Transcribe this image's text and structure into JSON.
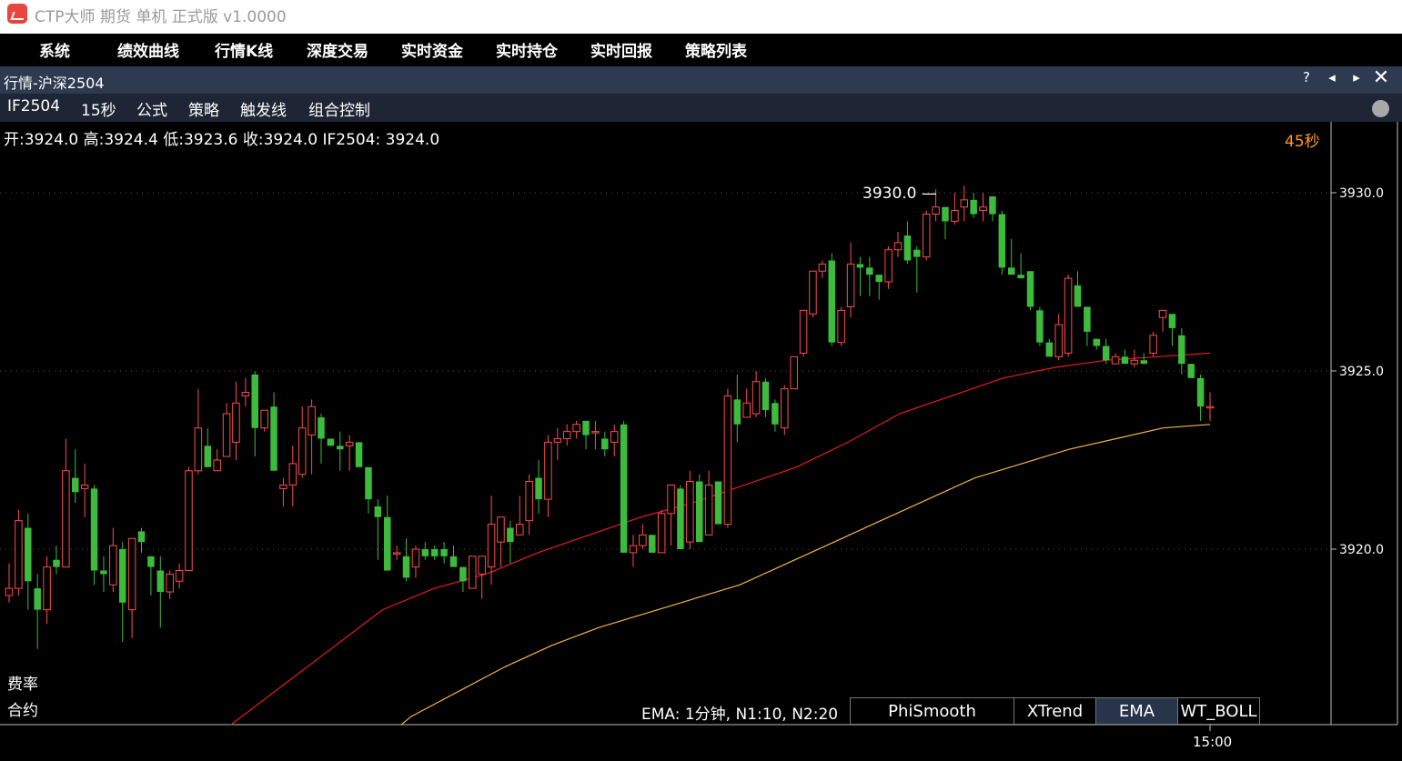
{
  "window": {
    "title": "CTP大师 期货 单机 正式版 v1.0000"
  },
  "menu": [
    "系统",
    "绩效曲线",
    "行情K线",
    "深度交易",
    "实时资金",
    "实时持仓",
    "实时回报",
    "策略列表"
  ],
  "panel": {
    "title": "行情-沪深2504",
    "help": "?",
    "prev": "◂",
    "next": "▸",
    "close": "✕"
  },
  "toolbar": [
    "IF2504",
    "15秒",
    "公式",
    "策略",
    "触发线",
    "组合控制"
  ],
  "quote_line": "开:3924.0 高:3924.4 低:3923.6 收:3924.0 IF2504: 3924.0",
  "period_label": "45秒",
  "high_marker": "3930.0 —",
  "side_labels": {
    "rate": "费率",
    "contract": "合约"
  },
  "indicator": {
    "info": "EMA: 1分钟, N1:10, N2:20",
    "tabs": [
      "PhiSmooth",
      "XTrend",
      "EMA",
      "WT_BOLL"
    ],
    "active": "EMA"
  },
  "colors": {
    "up": "#ff4b4b",
    "down": "#3dbb3d",
    "ema_fast": "#e81c1c",
    "ema_slow": "#f2b24a",
    "accent": "#ff9a1e"
  },
  "chart_data": {
    "type": "candlestick",
    "symbol": "IF2504",
    "period": "15秒",
    "y_ticks": [
      3930.0,
      3925.0,
      3920.0
    ],
    "x_ticks": [
      "15:00"
    ],
    "ohlc": [
      [
        3918.7,
        3919.6,
        3918.5,
        3918.9
      ],
      [
        3918.9,
        3921.1,
        3918.7,
        3920.8
      ],
      [
        3920.6,
        3921.0,
        3918.3,
        3919.1
      ],
      [
        3918.9,
        3919.3,
        3917.2,
        3918.3
      ],
      [
        3918.3,
        3919.8,
        3917.9,
        3919.5
      ],
      [
        3919.7,
        3920.1,
        3919.3,
        3919.5
      ],
      [
        3919.5,
        3923.1,
        3919.5,
        3922.2
      ],
      [
        3922.0,
        3922.8,
        3921.3,
        3921.6
      ],
      [
        3921.7,
        3922.4,
        3920.9,
        3921.8
      ],
      [
        3921.7,
        3921.8,
        3919.0,
        3919.4
      ],
      [
        3919.4,
        3919.8,
        3918.8,
        3919.3
      ],
      [
        3919.0,
        3920.6,
        3918.8,
        3920.1
      ],
      [
        3920.0,
        3920.2,
        3917.4,
        3918.5
      ],
      [
        3918.3,
        3920.2,
        3917.5,
        3920.3
      ],
      [
        3920.5,
        3920.6,
        3919.9,
        3920.2
      ],
      [
        3919.8,
        3919.8,
        3918.7,
        3919.5
      ],
      [
        3919.4,
        3919.8,
        3917.8,
        3918.8
      ],
      [
        3918.8,
        3919.4,
        3918.6,
        3919.3
      ],
      [
        3919.1,
        3919.6,
        3918.9,
        3919.4
      ],
      [
        3919.4,
        3922.3,
        3919.4,
        3922.2
      ],
      [
        3922.2,
        3924.5,
        3922.1,
        3923.4
      ],
      [
        3922.9,
        3923.4,
        3922.4,
        3922.3
      ],
      [
        3922.2,
        3922.8,
        3922.2,
        3922.5
      ],
      [
        3922.6,
        3924.1,
        3922.6,
        3923.8
      ],
      [
        3923.0,
        3924.7,
        3922.5,
        3924.1
      ],
      [
        3924.3,
        3924.8,
        3924.0,
        3924.4
      ],
      [
        3924.9,
        3925.0,
        3922.6,
        3923.4
      ],
      [
        3923.4,
        3923.8,
        3923.3,
        3923.9
      ],
      [
        3924.0,
        3924.4,
        3922.3,
        3922.2
      ],
      [
        3921.7,
        3922.0,
        3921.2,
        3921.8
      ],
      [
        3921.8,
        3922.9,
        3921.2,
        3922.4
      ],
      [
        3922.1,
        3924.0,
        3922.0,
        3923.4
      ],
      [
        3923.2,
        3924.2,
        3922.1,
        3924.0
      ],
      [
        3923.7,
        3923.8,
        3922.4,
        3923.1
      ],
      [
        3923.1,
        3923.1,
        3923.0,
        3922.9
      ],
      [
        3922.9,
        3923.3,
        3922.2,
        3922.8
      ],
      [
        3922.9,
        3923.2,
        3922.2,
        3923.0
      ],
      [
        3923.0,
        3923.0,
        3922.6,
        3922.3
      ],
      [
        3922.3,
        3922.3,
        3921.0,
        3921.4
      ],
      [
        3921.2,
        3921.4,
        3919.7,
        3920.9
      ],
      [
        3920.9,
        3921.5,
        3919.4,
        3919.4
      ],
      [
        3919.9,
        3920.1,
        3919.7,
        3919.9
      ],
      [
        3919.8,
        3920.3,
        3919.1,
        3919.2
      ],
      [
        3919.5,
        3920.1,
        3919.2,
        3920.0
      ],
      [
        3920.0,
        3920.2,
        3919.7,
        3919.8
      ],
      [
        3920.0,
        3920.1,
        3919.7,
        3919.8
      ],
      [
        3920.0,
        3920.2,
        3919.6,
        3919.8
      ],
      [
        3919.8,
        3920.1,
        3919.5,
        3919.5
      ],
      [
        3919.5,
        3919.5,
        3918.8,
        3919.1
      ],
      [
        3918.9,
        3919.4,
        3918.9,
        3919.8
      ],
      [
        3919.3,
        3919.7,
        3918.6,
        3919.8
      ],
      [
        3919.5,
        3921.5,
        3919.0,
        3920.7
      ],
      [
        3920.2,
        3920.8,
        3919.5,
        3920.9
      ],
      [
        3920.6,
        3920.8,
        3919.6,
        3920.2
      ],
      [
        3920.4,
        3921.5,
        3920.4,
        3920.7
      ],
      [
        3920.8,
        3922.1,
        3920.4,
        3921.9
      ],
      [
        3922.0,
        3922.5,
        3921.0,
        3921.4
      ],
      [
        3921.4,
        3923.2,
        3920.9,
        3923.0
      ],
      [
        3923.0,
        3923.4,
        3922.5,
        3923.1
      ],
      [
        3923.1,
        3923.5,
        3922.9,
        3923.3
      ],
      [
        3923.3,
        3923.6,
        3923.1,
        3923.5
      ],
      [
        3923.6,
        3923.6,
        3922.8,
        3923.2
      ],
      [
        3923.3,
        3923.6,
        3922.8,
        3923.3
      ],
      [
        3923.1,
        3923.3,
        3922.6,
        3922.8
      ],
      [
        3923.0,
        3923.5,
        3922.6,
        3923.3
      ],
      [
        3923.5,
        3923.6,
        3919.9,
        3919.9
      ],
      [
        3919.9,
        3920.4,
        3919.5,
        3920.1
      ],
      [
        3920.1,
        3920.7,
        3920.0,
        3920.4
      ],
      [
        3920.4,
        3920.4,
        3920.0,
        3919.9
      ],
      [
        3919.9,
        3921.1,
        3919.9,
        3921.0
      ],
      [
        3921.0,
        3921.6,
        3920.1,
        3921.8
      ],
      [
        3921.7,
        3921.8,
        3920.5,
        3920.0
      ],
      [
        3920.2,
        3922.2,
        3920.0,
        3921.9
      ],
      [
        3921.9,
        3922.1,
        3920.8,
        3920.2
      ],
      [
        3920.4,
        3922.2,
        3920.4,
        3921.8
      ],
      [
        3921.9,
        3921.9,
        3920.7,
        3920.7
      ],
      [
        3920.7,
        3924.5,
        3920.6,
        3924.3
      ],
      [
        3924.2,
        3924.9,
        3923.0,
        3923.5
      ],
      [
        3923.7,
        3924.5,
        3923.7,
        3924.1
      ],
      [
        3923.8,
        3925.0,
        3923.7,
        3924.7
      ],
      [
        3924.7,
        3924.8,
        3923.7,
        3923.9
      ],
      [
        3924.1,
        3924.2,
        3923.3,
        3923.5
      ],
      [
        3923.4,
        3924.6,
        3923.2,
        3924.5
      ],
      [
        3924.5,
        3925.4,
        3924.5,
        3925.4
      ],
      [
        3925.5,
        3926.6,
        3925.4,
        3926.7
      ],
      [
        3926.6,
        3927.8,
        3926.5,
        3927.8
      ],
      [
        3927.8,
        3928.1,
        3927.6,
        3928.0
      ],
      [
        3928.1,
        3928.3,
        3925.7,
        3925.8
      ],
      [
        3925.8,
        3926.8,
        3925.7,
        3926.7
      ],
      [
        3926.8,
        3928.6,
        3926.5,
        3928.0
      ],
      [
        3928.0,
        3928.2,
        3927.1,
        3927.9
      ],
      [
        3927.9,
        3928.2,
        3927.1,
        3927.7
      ],
      [
        3927.7,
        3927.6,
        3927.0,
        3927.5
      ],
      [
        3927.5,
        3928.5,
        3927.3,
        3928.4
      ],
      [
        3928.4,
        3928.9,
        3928.2,
        3928.6
      ],
      [
        3928.8,
        3929.2,
        3928.0,
        3928.1
      ],
      [
        3928.4,
        3928.5,
        3927.2,
        3928.2
      ],
      [
        3928.2,
        3929.5,
        3928.1,
        3929.4
      ],
      [
        3929.4,
        3930.1,
        3929.2,
        3929.6
      ],
      [
        3929.6,
        3929.6,
        3928.7,
        3929.2
      ],
      [
        3929.2,
        3930.0,
        3929.1,
        3929.5
      ],
      [
        3929.6,
        3930.2,
        3929.2,
        3929.8
      ],
      [
        3929.8,
        3930.0,
        3929.3,
        3929.4
      ],
      [
        3929.5,
        3930.0,
        3929.2,
        3929.6
      ],
      [
        3929.9,
        3929.9,
        3929.2,
        3929.4
      ],
      [
        3929.4,
        3929.5,
        3927.7,
        3927.9
      ],
      [
        3927.9,
        3928.7,
        3927.8,
        3927.7
      ],
      [
        3927.7,
        3928.3,
        3927.6,
        3927.6
      ],
      [
        3927.8,
        3927.8,
        3926.7,
        3926.8
      ],
      [
        3926.7,
        3926.8,
        3925.7,
        3925.8
      ],
      [
        3925.8,
        3925.9,
        3925.4,
        3925.4
      ],
      [
        3925.4,
        3926.6,
        3925.3,
        3926.3
      ],
      [
        3925.5,
        3927.7,
        3925.4,
        3927.6
      ],
      [
        3927.4,
        3927.8,
        3926.8,
        3926.8
      ],
      [
        3926.8,
        3926.8,
        3925.7,
        3926.1
      ],
      [
        3925.9,
        3925.9,
        3925.6,
        3925.7
      ],
      [
        3925.7,
        3925.9,
        3925.2,
        3925.3
      ],
      [
        3925.2,
        3925.5,
        3925.2,
        3925.4
      ],
      [
        3925.4,
        3925.6,
        3925.2,
        3925.2
      ],
      [
        3925.2,
        3925.6,
        3925.1,
        3925.3
      ],
      [
        3925.3,
        3925.5,
        3925.2,
        3925.2
      ],
      [
        3925.5,
        3926.1,
        3925.4,
        3926.0
      ],
      [
        3926.5,
        3926.6,
        3926.1,
        3926.7
      ],
      [
        3926.6,
        3926.6,
        3925.7,
        3926.2
      ],
      [
        3926.0,
        3926.2,
        3924.9,
        3925.2
      ],
      [
        3925.2,
        3925.2,
        3924.9,
        3924.8
      ],
      [
        3924.8,
        3924.9,
        3923.6,
        3924.0
      ],
      [
        3924.0,
        3924.4,
        3923.6,
        3924.0
      ]
    ],
    "ema_fast": [
      3915.0,
      3916.1,
      3917.2,
      3918.3,
      3918.9,
      3919.3,
      3919.9,
      3920.4,
      3920.9,
      3921.3,
      3921.8,
      3922.3,
      3923.0,
      3923.8,
      3924.3,
      3924.8,
      3925.1,
      3925.3,
      3925.4,
      3925.5
    ],
    "ema_slow": [
      3914.2,
      3915.3,
      3916.0,
      3916.7,
      3917.3,
      3917.8,
      3918.2,
      3918.6,
      3919.0,
      3919.6,
      3920.2,
      3920.8,
      3921.4,
      3922.0,
      3922.4,
      3922.8,
      3923.1,
      3923.4,
      3923.5
    ]
  }
}
